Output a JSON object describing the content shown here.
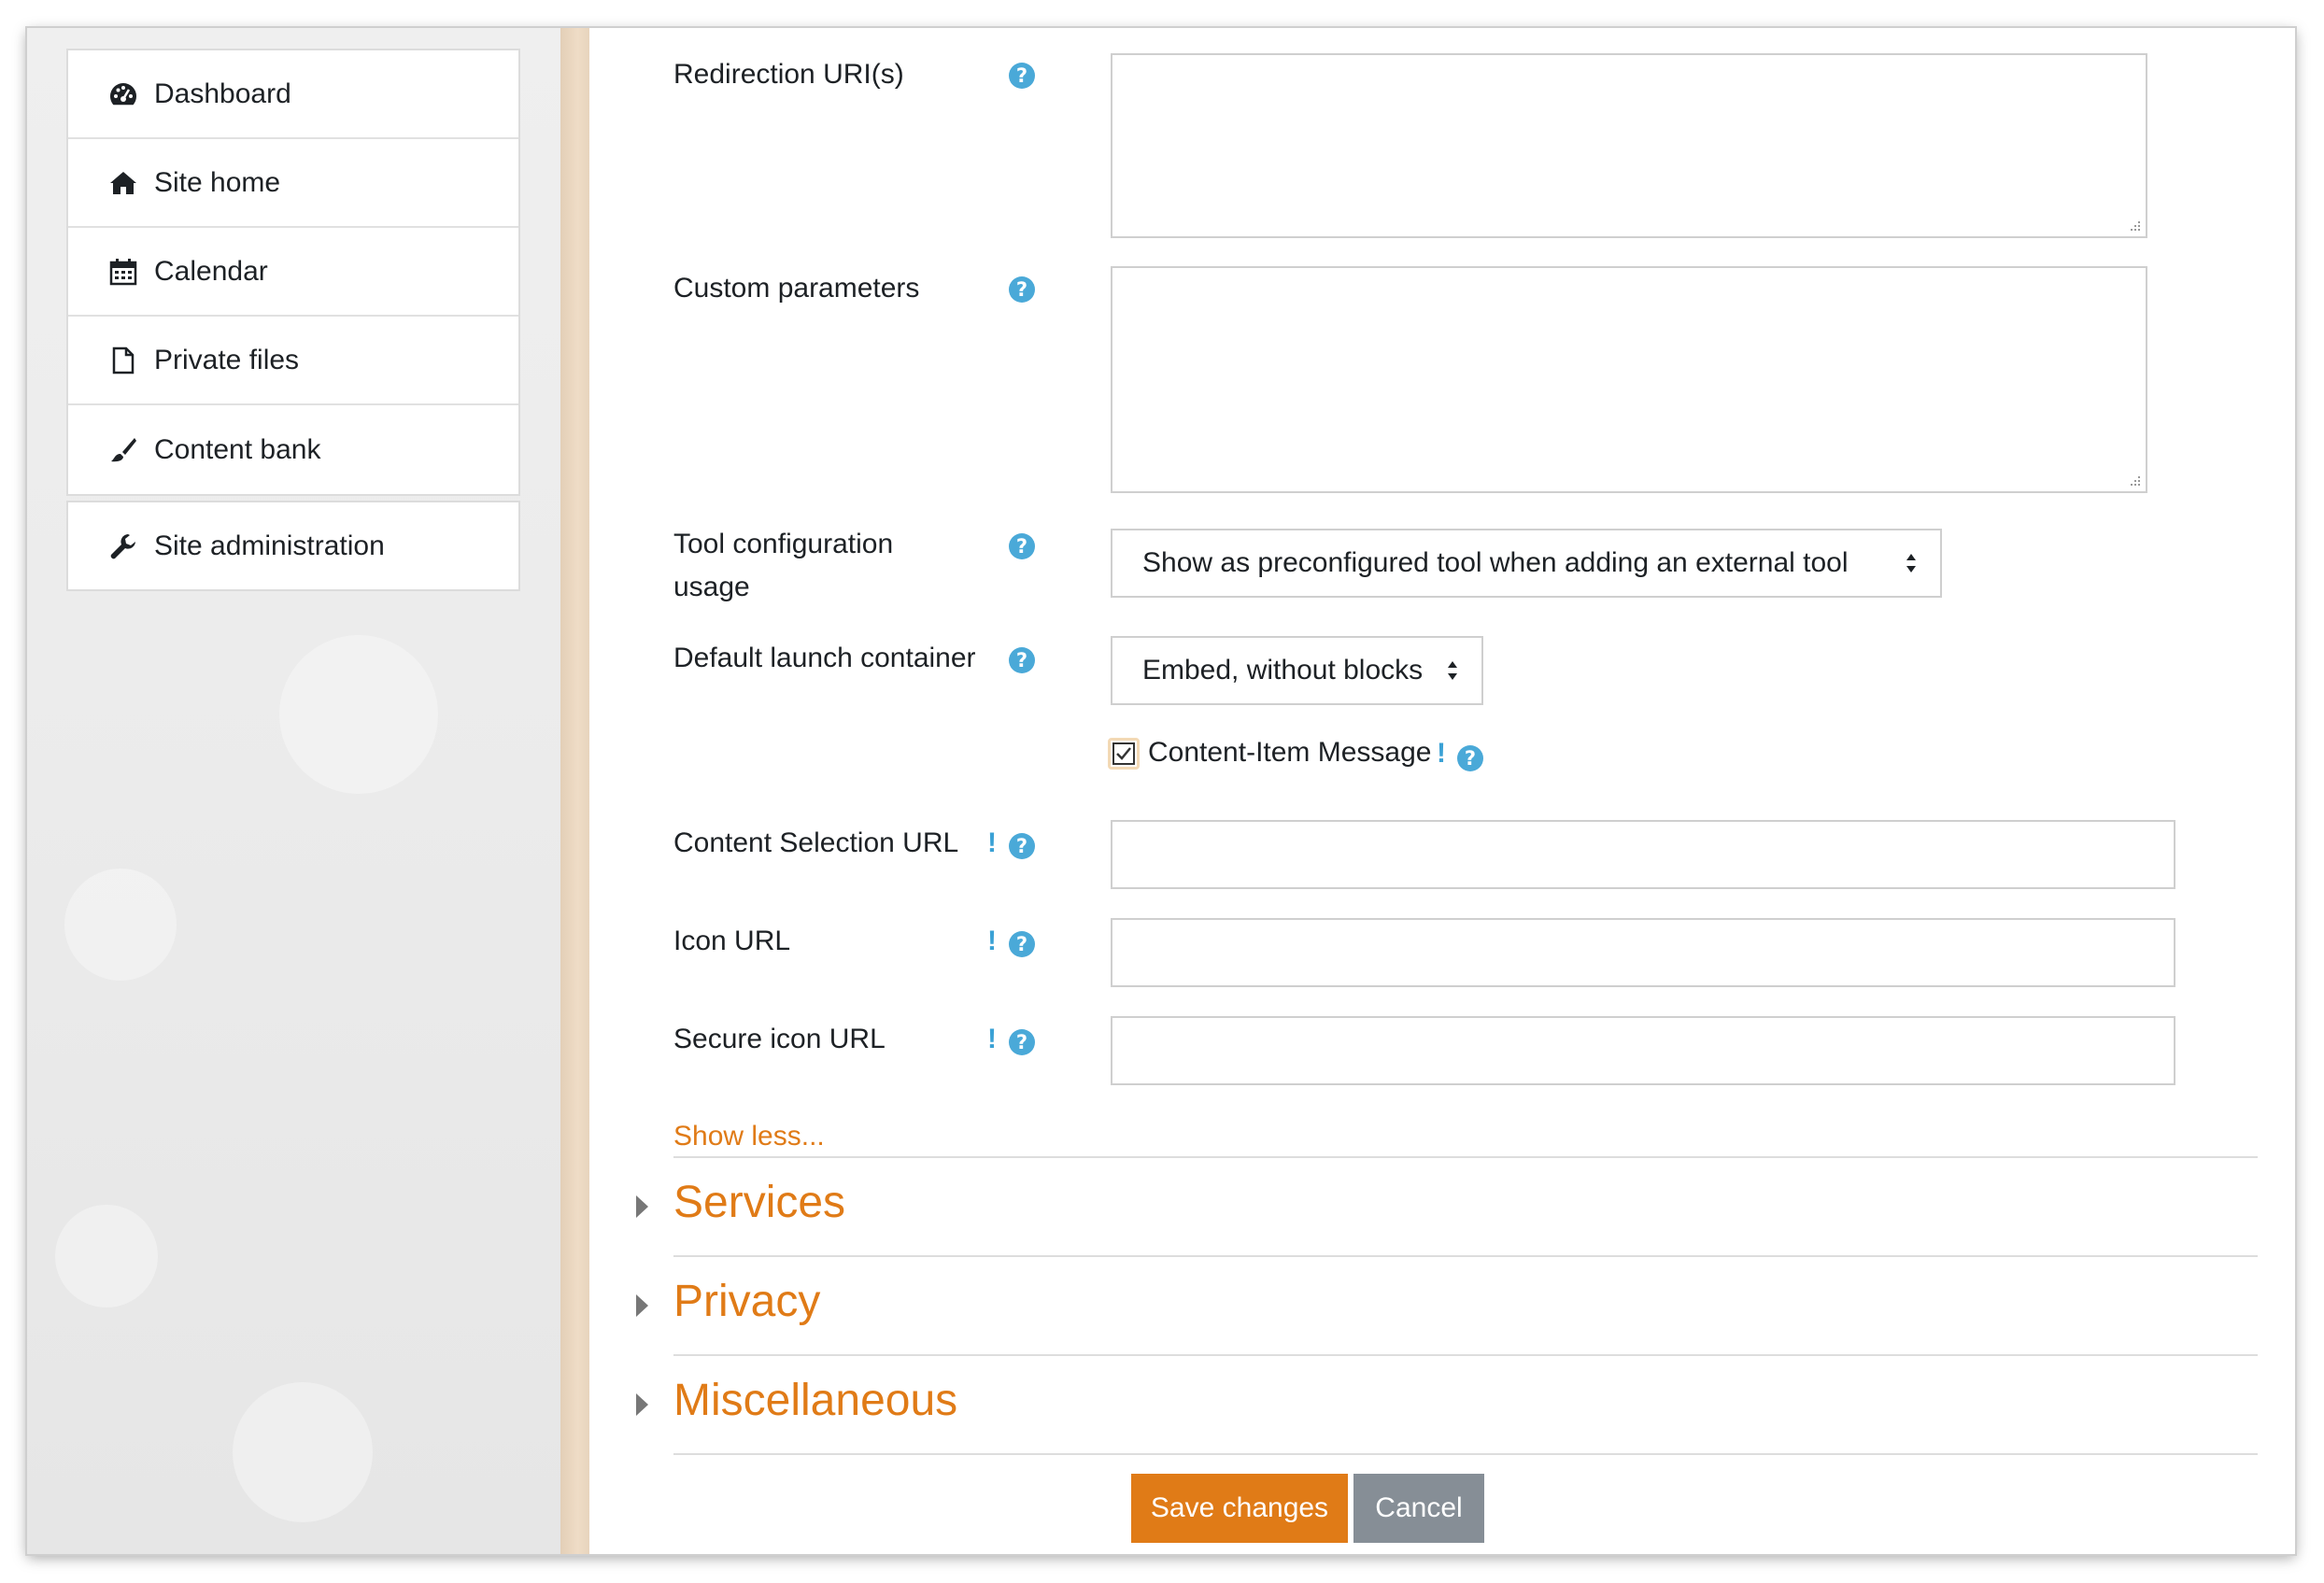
{
  "nav": {
    "items": [
      {
        "label": "Dashboard",
        "icon": "dashboard-icon"
      },
      {
        "label": "Site home",
        "icon": "home-icon"
      },
      {
        "label": "Calendar",
        "icon": "calendar-icon"
      },
      {
        "label": "Private files",
        "icon": "file-icon"
      },
      {
        "label": "Content bank",
        "icon": "brush-icon"
      }
    ],
    "admin": {
      "label": "Site administration",
      "icon": "wrench-icon"
    }
  },
  "form": {
    "redirection_uris": {
      "label": "Redirection URI(s)",
      "value": ""
    },
    "custom_parameters": {
      "label": "Custom parameters",
      "value": ""
    },
    "tool_config_usage": {
      "label_line1": "Tool configuration",
      "label_line2": "usage",
      "selected": "Show as preconfigured tool when adding an external tool"
    },
    "default_launch_container": {
      "label": "Default launch container",
      "selected": "Embed, without blocks"
    },
    "content_item": {
      "label": "Content-Item Message",
      "checked": true,
      "warn": "!"
    },
    "content_selection_url": {
      "label": "Content Selection URL",
      "value": "",
      "warn": "!"
    },
    "icon_url": {
      "label": "Icon URL",
      "value": "",
      "warn": "!"
    },
    "secure_icon_url": {
      "label": "Secure icon URL",
      "value": "",
      "warn": "!"
    },
    "show_less": "Show less..."
  },
  "sections": [
    "Services",
    "Privacy",
    "Miscellaneous"
  ],
  "buttons": {
    "save": "Save changes",
    "cancel": "Cancel"
  },
  "colors": {
    "accent": "#e07b17",
    "help": "#4aa9d8",
    "cancel": "#868e96"
  }
}
